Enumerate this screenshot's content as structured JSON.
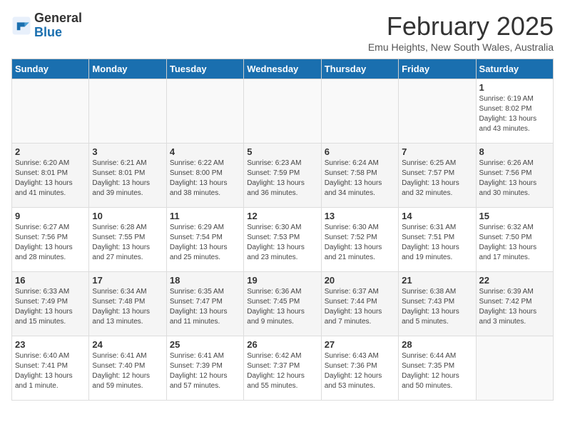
{
  "header": {
    "logo_general": "General",
    "logo_blue": "Blue",
    "month_title": "February 2025",
    "location": "Emu Heights, New South Wales, Australia"
  },
  "weekdays": [
    "Sunday",
    "Monday",
    "Tuesday",
    "Wednesday",
    "Thursday",
    "Friday",
    "Saturday"
  ],
  "weeks": [
    [
      {
        "day": "",
        "info": ""
      },
      {
        "day": "",
        "info": ""
      },
      {
        "day": "",
        "info": ""
      },
      {
        "day": "",
        "info": ""
      },
      {
        "day": "",
        "info": ""
      },
      {
        "day": "",
        "info": ""
      },
      {
        "day": "1",
        "info": "Sunrise: 6:19 AM\nSunset: 8:02 PM\nDaylight: 13 hours and 43 minutes."
      }
    ],
    [
      {
        "day": "2",
        "info": "Sunrise: 6:20 AM\nSunset: 8:01 PM\nDaylight: 13 hours and 41 minutes."
      },
      {
        "day": "3",
        "info": "Sunrise: 6:21 AM\nSunset: 8:01 PM\nDaylight: 13 hours and 39 minutes."
      },
      {
        "day": "4",
        "info": "Sunrise: 6:22 AM\nSunset: 8:00 PM\nDaylight: 13 hours and 38 minutes."
      },
      {
        "day": "5",
        "info": "Sunrise: 6:23 AM\nSunset: 7:59 PM\nDaylight: 13 hours and 36 minutes."
      },
      {
        "day": "6",
        "info": "Sunrise: 6:24 AM\nSunset: 7:58 PM\nDaylight: 13 hours and 34 minutes."
      },
      {
        "day": "7",
        "info": "Sunrise: 6:25 AM\nSunset: 7:57 PM\nDaylight: 13 hours and 32 minutes."
      },
      {
        "day": "8",
        "info": "Sunrise: 6:26 AM\nSunset: 7:56 PM\nDaylight: 13 hours and 30 minutes."
      }
    ],
    [
      {
        "day": "9",
        "info": "Sunrise: 6:27 AM\nSunset: 7:56 PM\nDaylight: 13 hours and 28 minutes."
      },
      {
        "day": "10",
        "info": "Sunrise: 6:28 AM\nSunset: 7:55 PM\nDaylight: 13 hours and 27 minutes."
      },
      {
        "day": "11",
        "info": "Sunrise: 6:29 AM\nSunset: 7:54 PM\nDaylight: 13 hours and 25 minutes."
      },
      {
        "day": "12",
        "info": "Sunrise: 6:30 AM\nSunset: 7:53 PM\nDaylight: 13 hours and 23 minutes."
      },
      {
        "day": "13",
        "info": "Sunrise: 6:30 AM\nSunset: 7:52 PM\nDaylight: 13 hours and 21 minutes."
      },
      {
        "day": "14",
        "info": "Sunrise: 6:31 AM\nSunset: 7:51 PM\nDaylight: 13 hours and 19 minutes."
      },
      {
        "day": "15",
        "info": "Sunrise: 6:32 AM\nSunset: 7:50 PM\nDaylight: 13 hours and 17 minutes."
      }
    ],
    [
      {
        "day": "16",
        "info": "Sunrise: 6:33 AM\nSunset: 7:49 PM\nDaylight: 13 hours and 15 minutes."
      },
      {
        "day": "17",
        "info": "Sunrise: 6:34 AM\nSunset: 7:48 PM\nDaylight: 13 hours and 13 minutes."
      },
      {
        "day": "18",
        "info": "Sunrise: 6:35 AM\nSunset: 7:47 PM\nDaylight: 13 hours and 11 minutes."
      },
      {
        "day": "19",
        "info": "Sunrise: 6:36 AM\nSunset: 7:45 PM\nDaylight: 13 hours and 9 minutes."
      },
      {
        "day": "20",
        "info": "Sunrise: 6:37 AM\nSunset: 7:44 PM\nDaylight: 13 hours and 7 minutes."
      },
      {
        "day": "21",
        "info": "Sunrise: 6:38 AM\nSunset: 7:43 PM\nDaylight: 13 hours and 5 minutes."
      },
      {
        "day": "22",
        "info": "Sunrise: 6:39 AM\nSunset: 7:42 PM\nDaylight: 13 hours and 3 minutes."
      }
    ],
    [
      {
        "day": "23",
        "info": "Sunrise: 6:40 AM\nSunset: 7:41 PM\nDaylight: 13 hours and 1 minute."
      },
      {
        "day": "24",
        "info": "Sunrise: 6:41 AM\nSunset: 7:40 PM\nDaylight: 12 hours and 59 minutes."
      },
      {
        "day": "25",
        "info": "Sunrise: 6:41 AM\nSunset: 7:39 PM\nDaylight: 12 hours and 57 minutes."
      },
      {
        "day": "26",
        "info": "Sunrise: 6:42 AM\nSunset: 7:37 PM\nDaylight: 12 hours and 55 minutes."
      },
      {
        "day": "27",
        "info": "Sunrise: 6:43 AM\nSunset: 7:36 PM\nDaylight: 12 hours and 53 minutes."
      },
      {
        "day": "28",
        "info": "Sunrise: 6:44 AM\nSunset: 7:35 PM\nDaylight: 12 hours and 50 minutes."
      },
      {
        "day": "",
        "info": ""
      }
    ]
  ]
}
